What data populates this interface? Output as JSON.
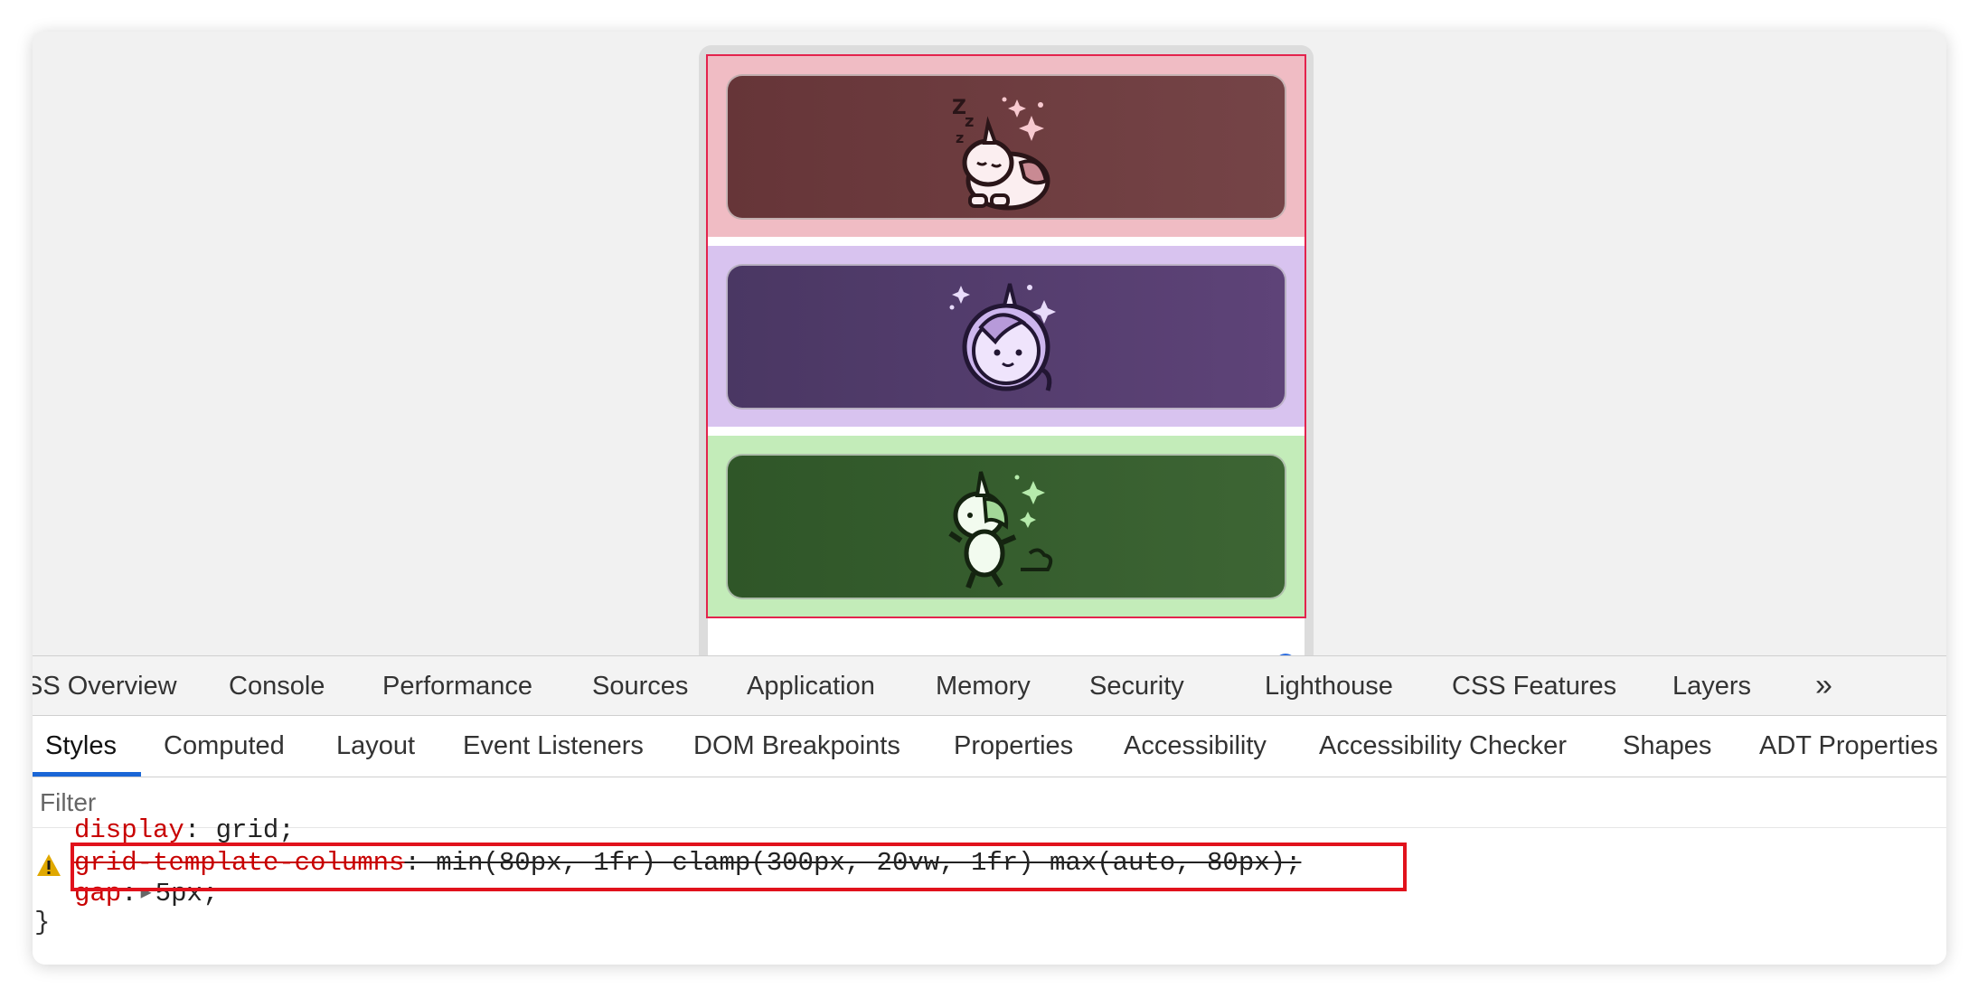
{
  "main_tabs": [
    {
      "label": "SS Overview"
    },
    {
      "label": "Console"
    },
    {
      "label": "Performance"
    },
    {
      "label": "Sources"
    },
    {
      "label": "Application"
    },
    {
      "label": "Memory"
    },
    {
      "label": "Security"
    },
    {
      "label": "Lighthouse"
    },
    {
      "label": "CSS Features"
    },
    {
      "label": "Layers"
    }
  ],
  "more_tabs_label": "»",
  "sub_tabs": [
    {
      "label": "Styles",
      "active": true
    },
    {
      "label": "Computed"
    },
    {
      "label": "Layout"
    },
    {
      "label": "Event Listeners"
    },
    {
      "label": "DOM Breakpoints"
    },
    {
      "label": "Properties"
    },
    {
      "label": "Accessibility"
    },
    {
      "label": "Accessibility Checker"
    },
    {
      "label": "Shapes"
    },
    {
      "label": "ADT Properties"
    }
  ],
  "filter": {
    "placeholder": "Filter"
  },
  "styles": {
    "line1_prop": "display",
    "line1_val": "grid;",
    "line2_prop": "grid-template-columns",
    "line2_val": "min(80px, 1fr) clamp(300px, 20vw, 1fr) max(auto, 80px);",
    "line3_prop": "gap",
    "line3_val": "5px;",
    "closing_brace": "}"
  },
  "cards": [
    {
      "name": "sleeping-unicorn",
      "color": "#6b393c",
      "row_color": "#f0bcc4"
    },
    {
      "name": "astronaut-unicorn",
      "color": "#523d6d",
      "row_color": "#d8c3ef"
    },
    {
      "name": "dancing-unicorn",
      "color": "#355c2d",
      "row_color": "#c3ecb9"
    }
  ],
  "colors": {
    "grid_outline": "#e3234d",
    "highlight": "#e1121c",
    "warning": "#e0a800",
    "active_tab": "#1a66d6"
  }
}
